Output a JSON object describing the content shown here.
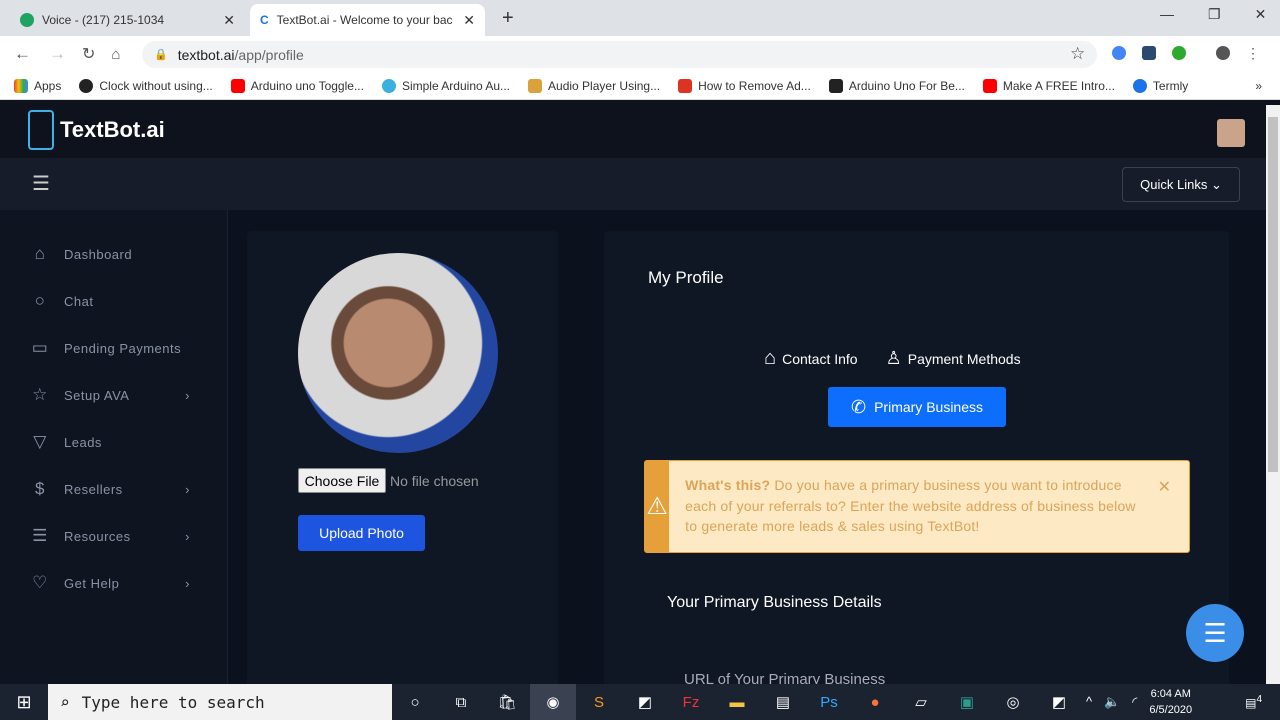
{
  "browser": {
    "tabs": [
      {
        "title": "Voice - (217) 215-1034",
        "active": false
      },
      {
        "title": "TextBot.ai - Welcome to your bac",
        "active": true
      }
    ],
    "url_domain": "textbot.ai",
    "url_path": "/app/profile",
    "bookmarks": [
      "Apps",
      "Clock without using...",
      "Arduino uno Toggle...",
      "Simple Arduino Au...",
      "Audio Player Using...",
      "How to Remove Ad...",
      "Arduino Uno For Be...",
      "Make A FREE Intro...",
      "Termly"
    ],
    "more": "»"
  },
  "app": {
    "logo": "TextBot.ai",
    "quick_links": "Quick Links",
    "sidebar": [
      {
        "label": "Dashboard",
        "icon": "home-icon"
      },
      {
        "label": "Chat",
        "icon": "chat-icon"
      },
      {
        "label": "Pending Payments",
        "icon": "credit-card-icon"
      },
      {
        "label": "Setup AVA",
        "icon": "star-icon",
        "chevron": true
      },
      {
        "label": "Leads",
        "icon": "filter-icon"
      },
      {
        "label": "Resellers",
        "icon": "dollar-icon",
        "chevron": true
      },
      {
        "label": "Resources",
        "icon": "list-icon",
        "chevron": true
      },
      {
        "label": "Get Help",
        "icon": "heart-icon",
        "chevron": true
      }
    ],
    "photo": {
      "choose_file": "Choose File",
      "no_file": "No file chosen",
      "upload": "Upload Photo"
    },
    "profile": {
      "title": "My Profile",
      "tabs": [
        "Contact Info",
        "Payment Methods",
        "Primary Business"
      ],
      "alert_strong": "What's this?",
      "alert_text": " Do you have a primary business you want to introduce each of your referrals to? Enter the website address of business below to generate more leads & sales using TextBot!",
      "section_title": "Your Primary Business Details",
      "field_label": "URL of Your Primary Business"
    }
  },
  "taskbar": {
    "search_placeholder": "Type here to search",
    "time": "6:04 AM",
    "date": "6/5/2020",
    "notifications": "4"
  },
  "colors": {
    "accent": "#0d6efd",
    "warning": "#e5a03a",
    "alert_bg": "#fde9c3"
  }
}
